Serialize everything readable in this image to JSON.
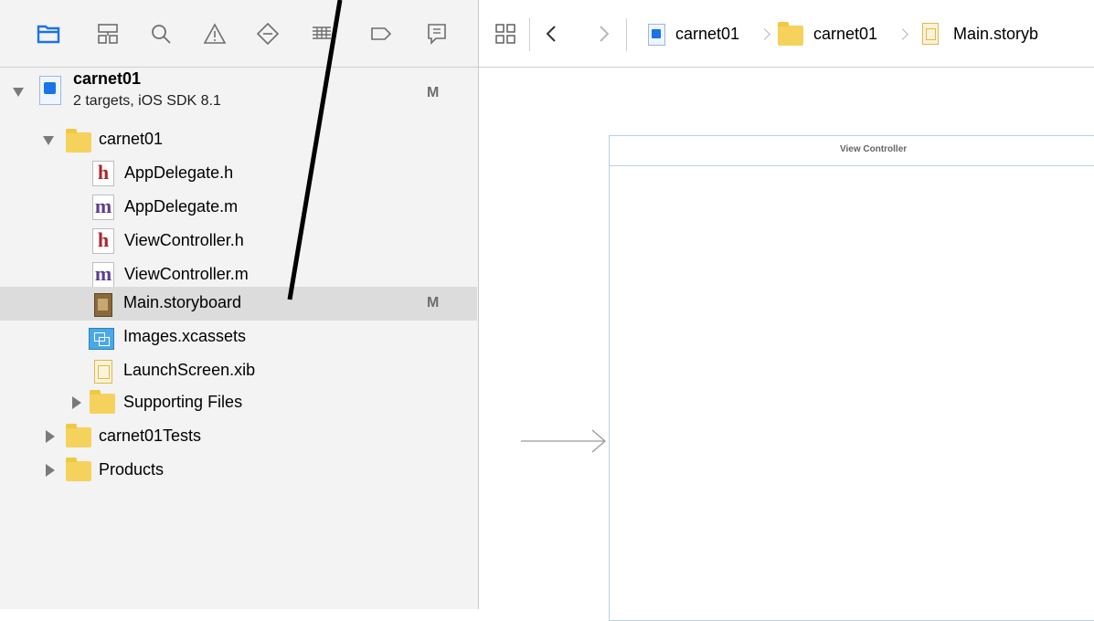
{
  "navigator": {
    "project": {
      "name": "carnet01",
      "subtitle": "2 targets, iOS SDK 8.1",
      "status": "M"
    },
    "items": [
      {
        "label": "carnet01",
        "kind": "folder"
      },
      {
        "label": "AppDelegate.h",
        "kind": "h",
        "glyph": "h"
      },
      {
        "label": "AppDelegate.m",
        "kind": "m",
        "glyph": "m"
      },
      {
        "label": "ViewController.h",
        "kind": "h",
        "glyph": "h"
      },
      {
        "label": "ViewController.m",
        "kind": "m",
        "glyph": "m"
      },
      {
        "label": "Main.storyboard",
        "kind": "storyboard",
        "status": "M"
      },
      {
        "label": "Images.xcassets",
        "kind": "xcassets"
      },
      {
        "label": "LaunchScreen.xib",
        "kind": "xib"
      },
      {
        "label": "Supporting Files",
        "kind": "folder"
      },
      {
        "label": "carnet01Tests",
        "kind": "folder"
      },
      {
        "label": "Products",
        "kind": "folder"
      }
    ]
  },
  "jumpbar": {
    "crumbs": [
      "carnet01",
      "carnet01",
      "Main.storyb"
    ]
  },
  "canvas": {
    "scene_title": "View Controller"
  },
  "colors": {
    "sidebar_bg": "#f3f3f3",
    "selection_bg": "#dcdcdc",
    "accent_blue": "#1a73e8",
    "folder_yellow": "#f5d25c",
    "h_red": "#b0252a",
    "m_purple": "#5a3e8c"
  }
}
